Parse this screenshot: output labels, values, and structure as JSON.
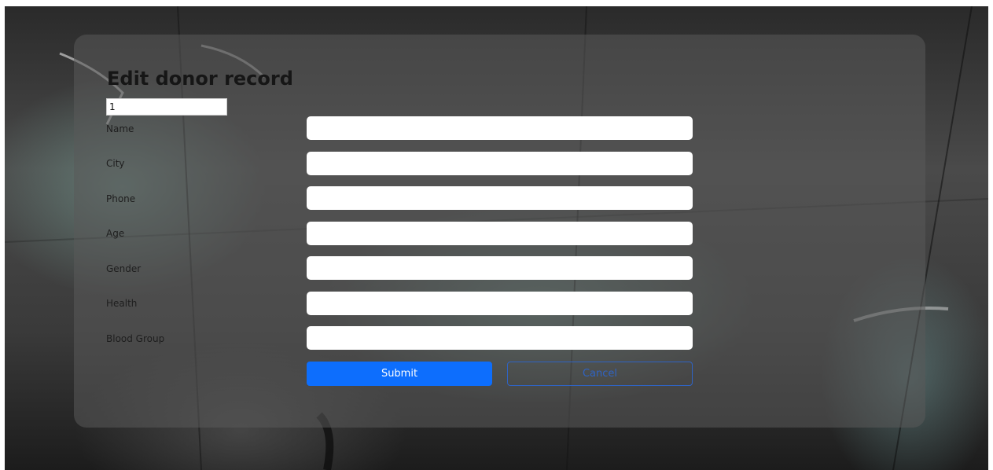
{
  "page": {
    "title": "Edit donor record"
  },
  "record": {
    "id_value": "1"
  },
  "form": {
    "fields": [
      {
        "label": "Name",
        "value": ""
      },
      {
        "label": "City",
        "value": ""
      },
      {
        "label": "Phone",
        "value": ""
      },
      {
        "label": "Age",
        "value": ""
      },
      {
        "label": "Gender",
        "value": ""
      },
      {
        "label": "Health",
        "value": ""
      },
      {
        "label": "Blood Group",
        "value": ""
      }
    ],
    "submit_label": "Submit",
    "cancel_label": "Cancel"
  },
  "colors": {
    "primary": "#0d6efd",
    "cancel_outline": "#2f63c4",
    "card_overlay": "rgba(90,90,90,0.55)"
  }
}
